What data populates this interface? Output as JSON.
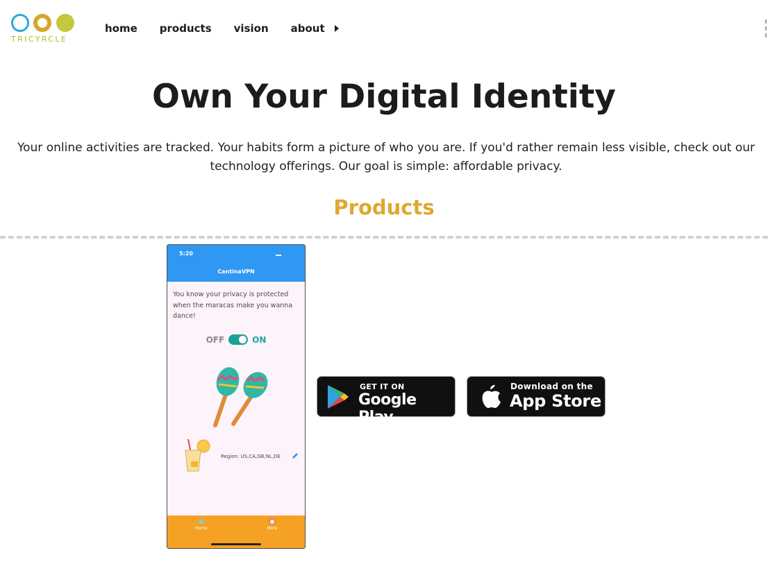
{
  "brand": {
    "name": "TRICYRCLE",
    "circle_colors": [
      "#2aa7dc",
      "#d7a62a",
      "#c3c83f"
    ]
  },
  "nav": {
    "items": [
      "home",
      "products",
      "vision",
      "about"
    ],
    "about_icon": "caret-right-icon"
  },
  "hero": {
    "title": "Own Your Digital Identity",
    "intro": "Your online activities are tracked. Your habits form a picture of who you are. If you'd rather remain less visible, check out our technology offerings. Our goal is simple: affordable privacy."
  },
  "products": {
    "heading": "Products",
    "heading_color": "#dca931"
  },
  "app_screenshot": {
    "time": "5:20",
    "app_name": "CantinaVPN",
    "message": "You know your privacy is protected when the maracas make you wanna dance!",
    "toggle_off": "OFF",
    "toggle_on": "ON",
    "region": "Region: US,CA,GB,NL,DE",
    "tab_home": "Home",
    "tab_more": "More",
    "header_color": "#2f98f2",
    "footer_color": "#f5a224"
  },
  "badges": {
    "google": {
      "small": "GET IT ON",
      "big": "Google Play",
      "icon": "google-play-icon"
    },
    "apple": {
      "small": "Download on the",
      "big": "App Store",
      "icon": "apple-icon"
    }
  }
}
